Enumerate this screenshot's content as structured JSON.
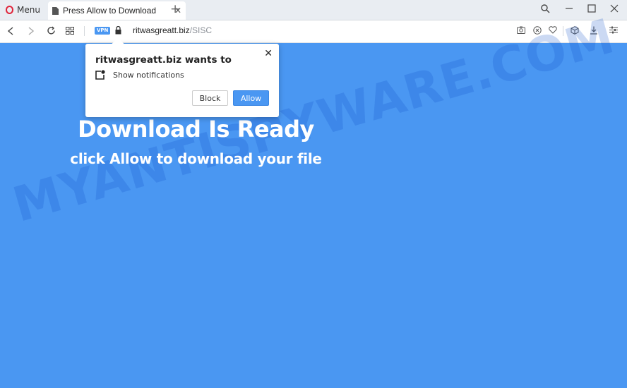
{
  "browser": {
    "menu_label": "Menu",
    "tab_title": "Press Allow to Download",
    "new_tab_symbol": "+",
    "vpn_label": "VPN",
    "url_host": "ritwasgreatt.biz",
    "url_path": "/SISC"
  },
  "page": {
    "headline": "Download Is Ready",
    "subline": "click Allow to download your file",
    "watermark": "MYANTISPYWARE.COM"
  },
  "popup": {
    "title": "ritwasgreatt.biz wants to",
    "permission": "Show notifications",
    "block_label": "Block",
    "allow_label": "Allow"
  },
  "colors": {
    "page_background": "#4a97f2",
    "accent": "#4a97f2",
    "opera_red": "#e0243a"
  }
}
